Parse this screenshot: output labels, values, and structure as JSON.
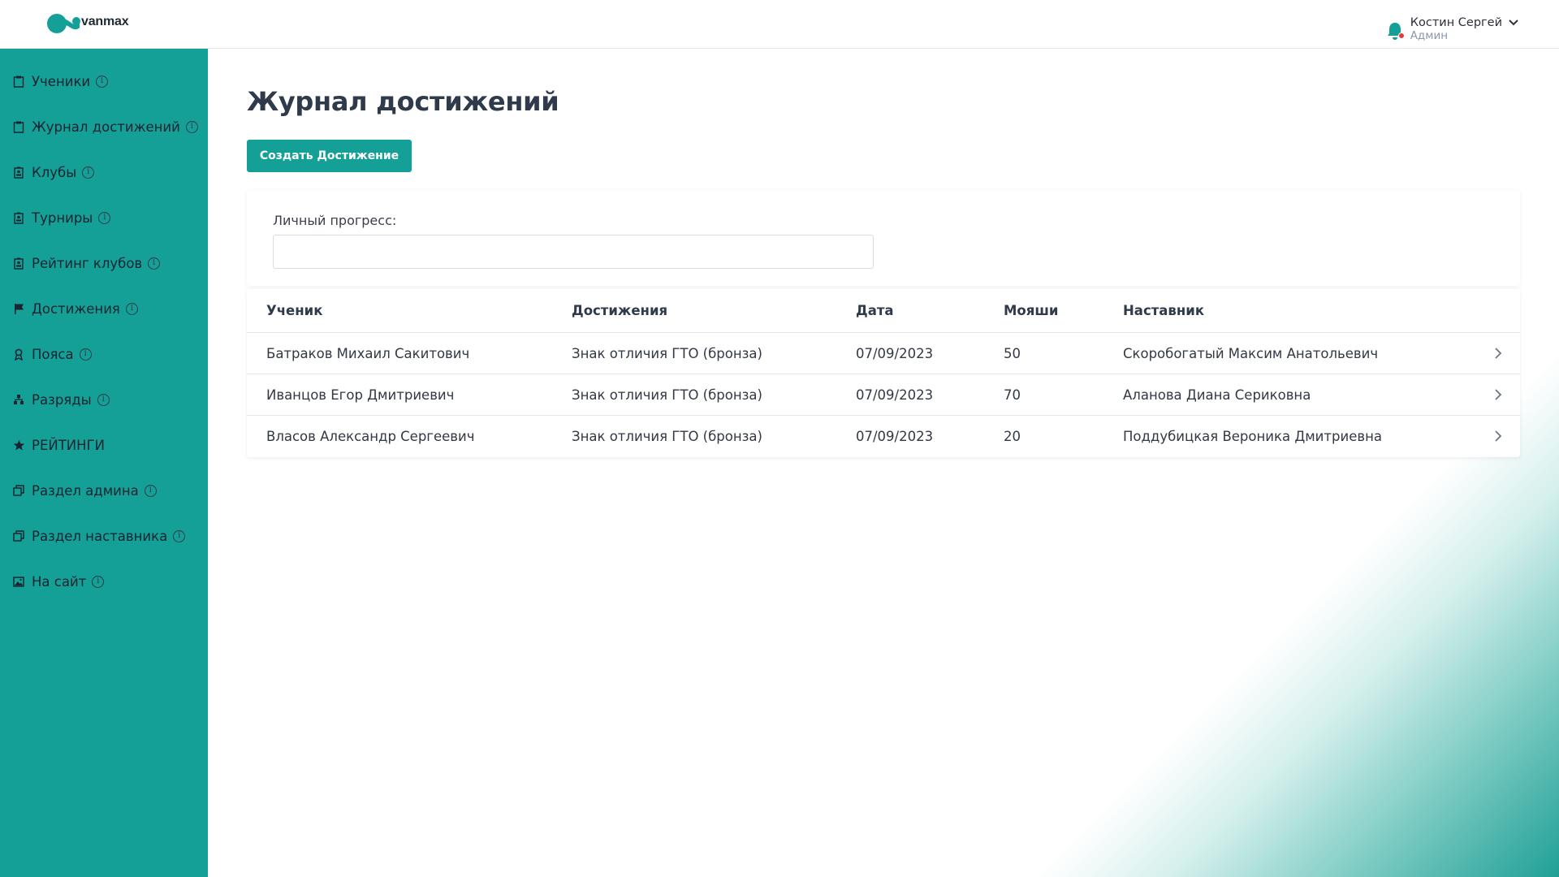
{
  "brand": {
    "name": "vanmax",
    "accent": "#14a097"
  },
  "user": {
    "name": "Костин Сергей",
    "role": "Админ"
  },
  "sidebar": {
    "items": [
      {
        "label": "Ученики",
        "icon": "clipboard-icon"
      },
      {
        "label": "Журнал достижений",
        "icon": "clipboard-icon"
      },
      {
        "label": "Клубы",
        "icon": "badge-icon"
      },
      {
        "label": "Турниры",
        "icon": "badge-icon"
      },
      {
        "label": "Рейтинг клубов",
        "icon": "badge-icon"
      },
      {
        "label": "Достижения",
        "icon": "flag-icon"
      },
      {
        "label": "Пояса",
        "icon": "ribbon-icon"
      },
      {
        "label": "Разряды",
        "icon": "hierarchy-icon"
      },
      {
        "label": "РЕЙТИНГИ",
        "icon": "star-icon"
      },
      {
        "label": "Раздел админа",
        "icon": "copy-icon"
      },
      {
        "label": "Раздел наставника",
        "icon": "copy-icon"
      },
      {
        "label": "На сайт",
        "icon": "image-icon"
      }
    ]
  },
  "main": {
    "title": "Журнал достижений",
    "create_button": "Создать Достижение",
    "filter": {
      "label": "Личный прогресс:",
      "value": ""
    }
  },
  "table": {
    "headers": [
      "Ученик",
      "Достижения",
      "Дата",
      "Мояши",
      "Наставник"
    ],
    "rows": [
      [
        "Батраков Михаил Сакитович",
        "Знак отличия ГТО (бронза)",
        "07/09/2023",
        "50",
        "Скоробогатый Максим Анатольевич"
      ],
      [
        "Иванцов Егор Дмитриевич",
        "Знак отличия ГТО (бронза)",
        "07/09/2023",
        "70",
        "Аланова Диана Сериковна"
      ],
      [
        "Власов Александр Сергеевич",
        "Знак отличия ГТО (бронза)",
        "07/09/2023",
        "20",
        "Поддубицкая Вероника Дмитриевна"
      ]
    ]
  }
}
